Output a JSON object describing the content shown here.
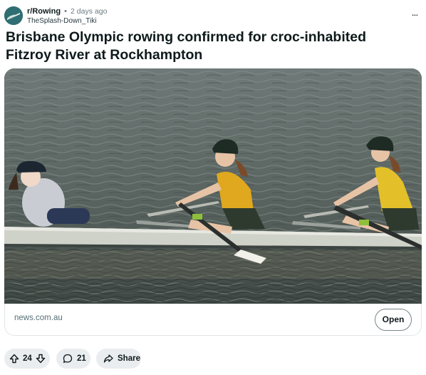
{
  "post": {
    "subreddit": "r/Rowing",
    "separator": "•",
    "age": "2 days ago",
    "author": "TheSplash-Down_Tiki",
    "more_label": "...",
    "title": "Brisbane Olympic rowing confirmed for croc-inhabited Fitzroy River at Rockhampton"
  },
  "link": {
    "domain": "news.com.au",
    "open_label": "Open"
  },
  "actions": {
    "score": "24",
    "comments": "21",
    "share_label": "Share"
  },
  "icons": {
    "upvote": "arrow-up-icon",
    "downvote": "arrow-down-icon",
    "comment": "speech-bubble-icon",
    "share": "share-arrow-icon",
    "more": "ellipsis-icon"
  },
  "colors": {
    "subreddit_avatar": "#2f6f73",
    "pill_background": "#eaedef",
    "water": "#5e6866",
    "boat_hull": "#cfd2c8",
    "rower_shirt": "#e0a81f"
  }
}
